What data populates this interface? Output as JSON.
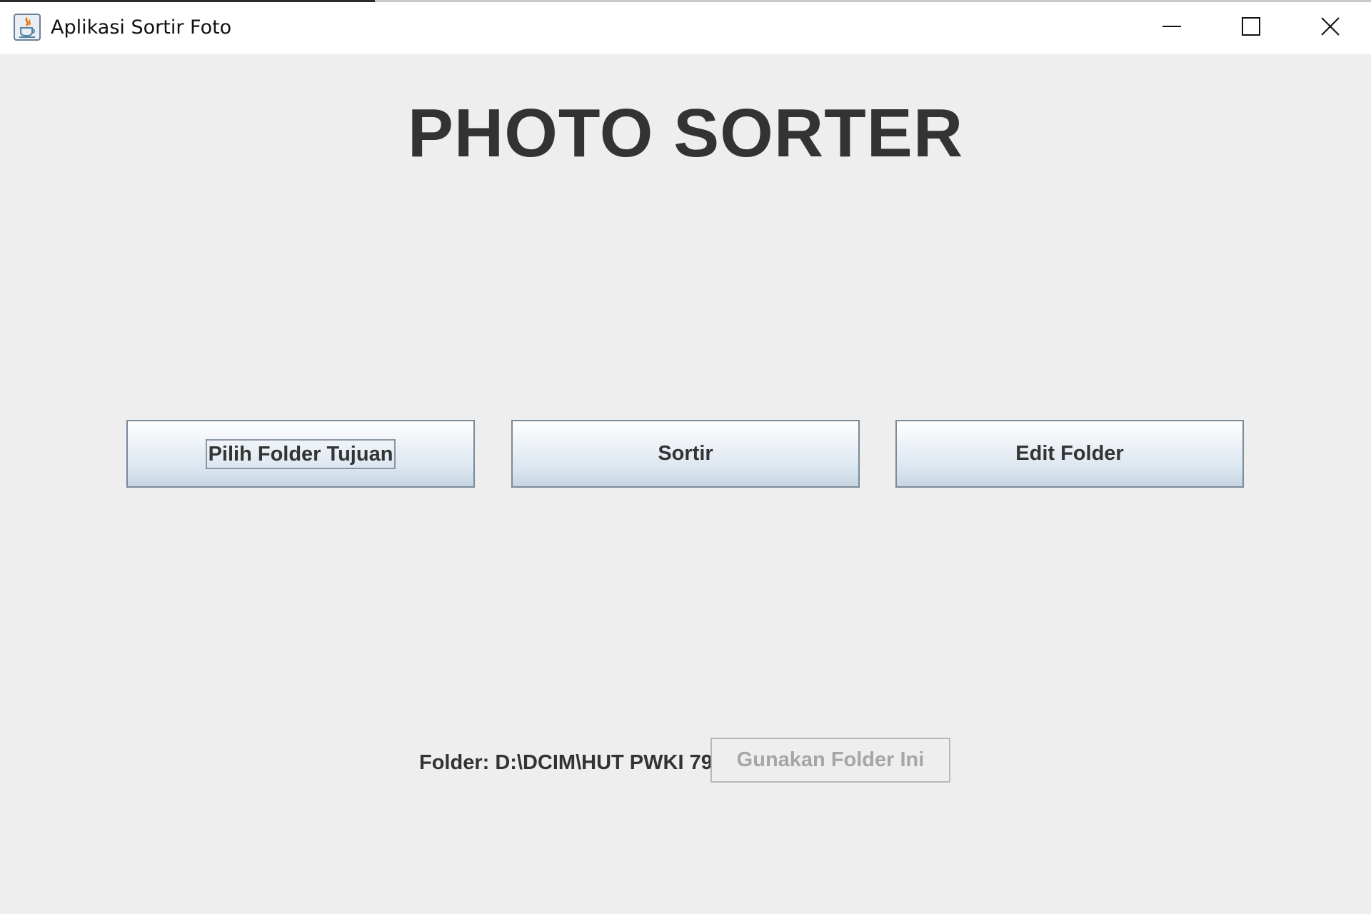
{
  "window": {
    "title": "Aplikasi Sortir Foto",
    "controls": {
      "minimize": "minimize-icon",
      "maximize": "maximize-icon",
      "close": "close-icon"
    }
  },
  "main": {
    "heading": "PHOTO SORTER",
    "buttons": {
      "choose_folder": "Pilih Folder Tujuan",
      "sort": "Sortir",
      "edit_folder": "Edit Folder"
    }
  },
  "footer": {
    "folder_label": "Folder: D:\\DCIM\\HUT PWKI 79",
    "use_folder_button": "Gunakan Folder Ini",
    "use_folder_button_state": "disabled"
  },
  "colors": {
    "background": "#eeeeee",
    "titlebar": "#ffffff",
    "text": "#333333",
    "disabled_text": "#a6a6a6",
    "button_border": "#7a8a99"
  }
}
